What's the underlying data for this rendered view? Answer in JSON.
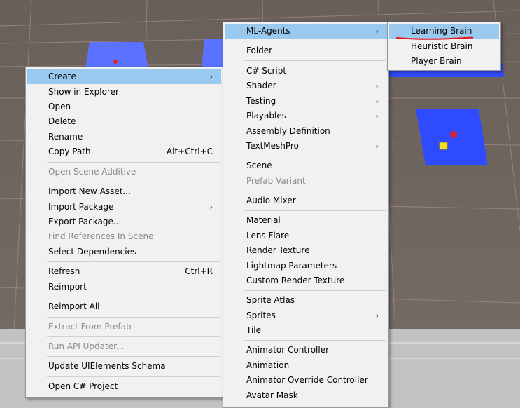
{
  "context_menu": {
    "items": [
      {
        "label": "Create",
        "arrow": "›",
        "highlighted": true
      },
      {
        "label": "Show in Explorer"
      },
      {
        "label": "Open"
      },
      {
        "label": "Delete"
      },
      {
        "label": "Rename"
      },
      {
        "label": "Copy Path",
        "shortcut": "Alt+Ctrl+C"
      },
      {
        "label": "Open Scene Additive",
        "disabled": true
      },
      {
        "label": "Import New Asset..."
      },
      {
        "label": "Import Package",
        "arrow": "›"
      },
      {
        "label": "Export Package..."
      },
      {
        "label": "Find References In Scene",
        "disabled": true
      },
      {
        "label": "Select Dependencies"
      },
      {
        "label": "Refresh",
        "shortcut": "Ctrl+R"
      },
      {
        "label": "Reimport"
      },
      {
        "label": "Reimport All"
      },
      {
        "label": "Extract From Prefab",
        "disabled": true
      },
      {
        "label": "Run API Updater...",
        "disabled": true
      },
      {
        "label": "Update UIElements Schema"
      },
      {
        "label": "Open C# Project"
      }
    ]
  },
  "create_submenu": {
    "items": [
      {
        "label": "ML-Agents",
        "arrow": "›",
        "highlighted": true
      },
      {
        "label": "Folder"
      },
      {
        "label": "C# Script"
      },
      {
        "label": "Shader",
        "arrow": "›"
      },
      {
        "label": "Testing",
        "arrow": "›"
      },
      {
        "label": "Playables",
        "arrow": "›"
      },
      {
        "label": "Assembly Definition"
      },
      {
        "label": "TextMeshPro",
        "arrow": "›"
      },
      {
        "label": "Scene"
      },
      {
        "label": "Prefab Variant",
        "disabled": true
      },
      {
        "label": "Audio Mixer"
      },
      {
        "label": "Material"
      },
      {
        "label": "Lens Flare"
      },
      {
        "label": "Render Texture"
      },
      {
        "label": "Lightmap Parameters"
      },
      {
        "label": "Custom Render Texture"
      },
      {
        "label": "Sprite Atlas"
      },
      {
        "label": "Sprites",
        "arrow": "›"
      },
      {
        "label": "Tile"
      },
      {
        "label": "Animator Controller"
      },
      {
        "label": "Animation"
      },
      {
        "label": "Animator Override Controller"
      },
      {
        "label": "Avatar Mask"
      }
    ]
  },
  "mlagents_submenu": {
    "items": [
      {
        "label": "Learning Brain",
        "highlighted": true
      },
      {
        "label": "Heuristic Brain"
      },
      {
        "label": "Player Brain"
      }
    ]
  },
  "colors": {
    "scene_background": "#6f655f",
    "grid_line": "#a88f86",
    "platform_blue": "#2f4bff",
    "platform_blue_light": "#5a72ff",
    "agent_red": "#e0202a",
    "goal_yellow": "#f2e020",
    "menu_background": "#f1f1f1",
    "highlight": "#99c9ef",
    "annotation_red": "#e8141c"
  }
}
